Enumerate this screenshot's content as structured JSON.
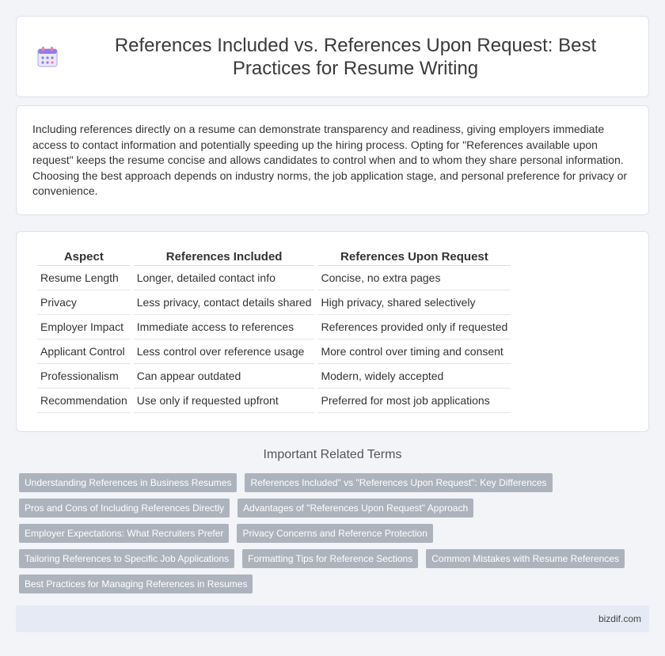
{
  "header": {
    "title": "References Included vs. References Upon Request: Best Practices for Resume Writing",
    "icon": "calendar-icon"
  },
  "intro": {
    "text": "Including references directly on a resume can demonstrate transparency and readiness, giving employers immediate access to contact information and potentially speeding up the hiring process. Opting for \"References available upon request\" keeps the resume concise and allows candidates to control when and to whom they share personal information. Choosing the best approach depends on industry norms, the job application stage, and personal preference for privacy or convenience."
  },
  "table": {
    "headers": [
      "Aspect",
      "References Included",
      "References Upon Request"
    ],
    "rows": [
      [
        "Resume Length",
        "Longer, detailed contact info",
        "Concise, no extra pages"
      ],
      [
        "Privacy",
        "Less privacy, contact details shared",
        "High privacy, shared selectively"
      ],
      [
        "Employer Impact",
        "Immediate access to references",
        "References provided only if requested"
      ],
      [
        "Applicant Control",
        "Less control over reference usage",
        "More control over timing and consent"
      ],
      [
        "Professionalism",
        "Can appear outdated",
        "Modern, widely accepted"
      ],
      [
        "Recommendation",
        "Use only if requested upfront",
        "Preferred for most job applications"
      ]
    ]
  },
  "related": {
    "title": "Important Related Terms",
    "tags": [
      "Understanding References in Business Resumes",
      "References Included\" vs \"References Upon Request\": Key Differences",
      "Pros and Cons of Including References Directly",
      "Advantages of \"References Upon Request\" Approach",
      "Employer Expectations: What Recruiters Prefer",
      "Privacy Concerns and Reference Protection",
      "Tailoring References to Specific Job Applications",
      "Formatting Tips for Reference Sections",
      "Common Mistakes with Resume References",
      "Best Practices for Managing References in Resumes"
    ]
  },
  "footer": {
    "brand": "bizdif.com"
  },
  "colors": {
    "tag_bg": "#adb3bd",
    "footer_bg": "#e6eaf4",
    "page_bg": "#f3f4f8"
  }
}
